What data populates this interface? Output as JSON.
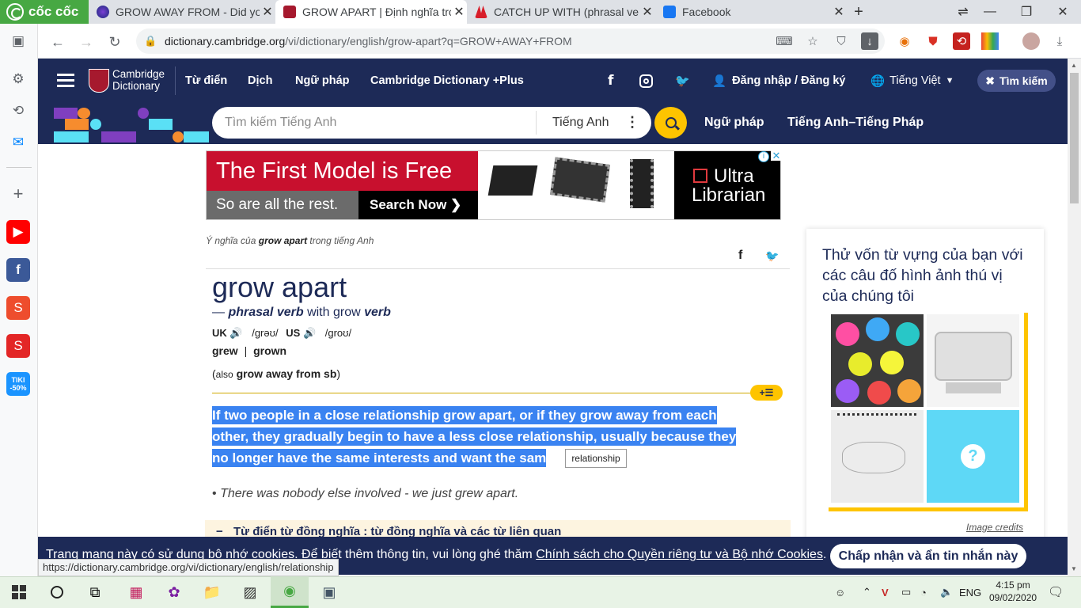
{
  "browser": {
    "brand": "cốc cốc",
    "tabs": [
      {
        "title": "GROW AWAY FROM - Did you",
        "icon": "globe-tab-icon",
        "active": false
      },
      {
        "title": "GROW APART | Định nghĩa trong",
        "icon": "cambridge-tab-icon",
        "active": true
      },
      {
        "title": "CATCH UP WITH (phrasal verb)",
        "icon": "red-logo-tab-icon",
        "active": false
      },
      {
        "title": "Facebook",
        "icon": "facebook-tab-icon",
        "active": false
      }
    ],
    "url_host": "dictionary.cambridge.org",
    "url_path": "/vi/dictionary/english/grow-apart?q=GROW+AWAY+FROM",
    "status_url": "https://dictionary.cambridge.org/vi/dictionary/english/relationship"
  },
  "site": {
    "logo_line1": "Cambridge",
    "logo_line2": "Dictionary",
    "nav": [
      "Từ điển",
      "Dịch",
      "Ngữ pháp",
      "Cambridge Dictionary +Plus"
    ],
    "login": "Đăng nhập / Đăng ký",
    "language": "Tiếng Việt",
    "search_button": "Tìm kiếm",
    "search_placeholder": "Tìm kiếm Tiếng Anh",
    "search_lang": "Tiếng Anh",
    "sub_links": [
      "Ngữ pháp",
      "Tiếng Anh–Tiếng Pháp"
    ]
  },
  "ad": {
    "headline": "The First Model is Free",
    "sub": "So are all the rest.",
    "cta": "Search Now ❯",
    "brand_line1": "Ultra",
    "brand_line2": "Librarian"
  },
  "entry": {
    "breadcrumb_prefix": "Ý nghĩa của",
    "breadcrumb_word": "grow apart",
    "breadcrumb_suffix": "trong tiếng Anh",
    "headword": "grow apart",
    "pos_dash": "—",
    "pos": "phrasal verb",
    "pos_with": "with grow",
    "pos_verb": "verb",
    "uk_label": "UK",
    "uk_ipa": "/ɡrəʊ/",
    "us_label": "US",
    "us_ipa": "/ɡroʊ/",
    "form1": "grew",
    "form_sep": "|",
    "form2": "grown",
    "also_open": "(",
    "also_label": "also",
    "also_phrase": "grow away from sb",
    "also_close": ")",
    "definition_lines": [
      "If two people in a close relationship grow apart, or if they grow away from each",
      "other, they gradually begin to have a less close relationship, usually because they",
      "no longer have the same interests and want the sam"
    ],
    "tooltip": "relationship",
    "example": "There was nobody else involved - we just grew apart.",
    "synonym_heading": "Từ điển từ đồng nghĩa : từ đồng nghĩa và các từ liên quan"
  },
  "quiz": {
    "title": "Thử vốn từ vựng của bạn với các câu đố hình ảnh thú vị của chúng tôi",
    "credits": "Image credits"
  },
  "cookie": {
    "text": "Trang mạng này có sử dụng bộ nhớ cookies. Để biết thêm thông tin, vui lòng ghé thăm",
    "link": "Chính sách cho Quyền riêng tư và Bộ nhớ Cookies",
    "button": "Chấp nhận và ẩn tin nhắn này"
  },
  "taskbar": {
    "time": "4:15 pm",
    "date": "09/02/2020",
    "lang": "ENG"
  },
  "colors": {
    "header": "#1d2a57",
    "accent": "#fec400",
    "highlight": "#3a83f1",
    "coccoc": "#47a843"
  }
}
